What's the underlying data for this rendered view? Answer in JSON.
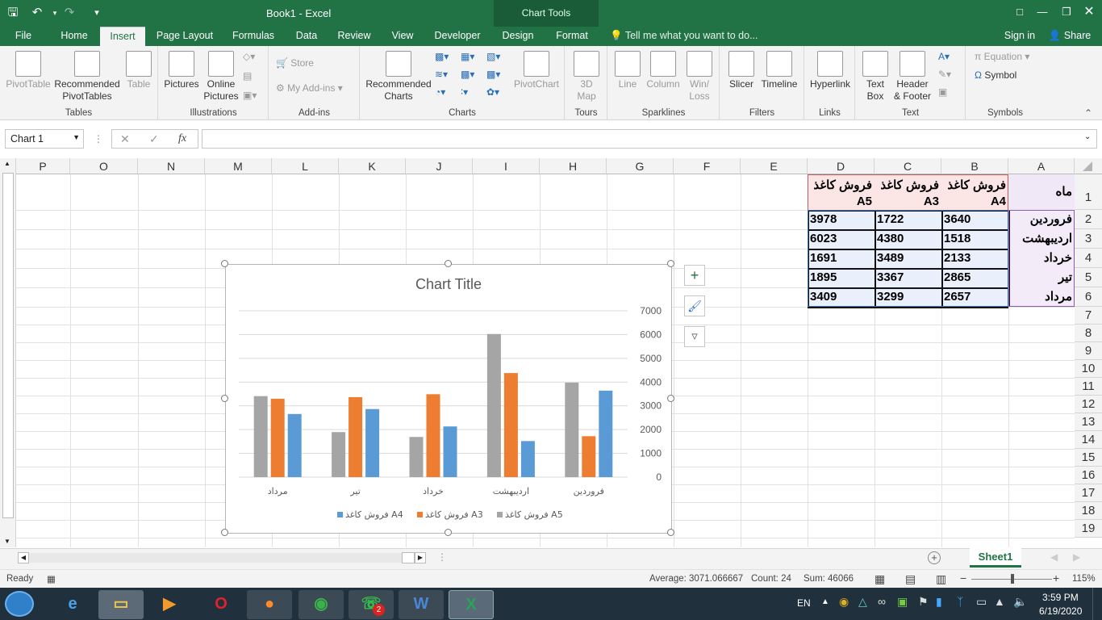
{
  "window": {
    "title": "Book1 - Excel",
    "chart_tools": "Chart Tools",
    "tell_me": "Tell me what you want to do...",
    "sign_in": "Sign in",
    "share": "Share"
  },
  "tabs": [
    "File",
    "Home",
    "Insert",
    "Page Layout",
    "Formulas",
    "Data",
    "Review",
    "View",
    "Developer",
    "Design",
    "Format"
  ],
  "active_tab": "Insert",
  "ribbon": {
    "tables": {
      "label": "Tables",
      "pivot": "PivotTable",
      "rec_pivot": "Recommended\nPivotTables",
      "table": "Table"
    },
    "illustrations": {
      "label": "Illustrations",
      "pictures": "Pictures",
      "online": "Online\nPictures"
    },
    "addins": {
      "label": "Add-ins",
      "store": "Store",
      "my_addins": "My Add-ins"
    },
    "charts": {
      "label": "Charts",
      "recommended": "Recommended\nCharts",
      "pivotchart": "PivotChart"
    },
    "tours": {
      "label": "Tours",
      "map": "3D\nMap"
    },
    "sparklines": {
      "label": "Sparklines",
      "line": "Line",
      "column": "Column",
      "winloss": "Win/\nLoss"
    },
    "filters": {
      "label": "Filters",
      "slicer": "Slicer",
      "timeline": "Timeline"
    },
    "links": {
      "label": "Links",
      "hyperlink": "Hyperlink"
    },
    "text": {
      "label": "Text",
      "textbox": "Text\nBox",
      "header": "Header\n& Footer"
    },
    "symbols": {
      "label": "Symbols",
      "equation": "Equation",
      "symbol": "Symbol"
    }
  },
  "formula_bar": {
    "name_box": "Chart 1",
    "fx": "fx",
    "value": ""
  },
  "columns": [
    "P",
    "O",
    "N",
    "M",
    "L",
    "K",
    "J",
    "I",
    "H",
    "G",
    "F",
    "E",
    "D",
    "C",
    "B",
    "A"
  ],
  "rows": [
    "1",
    "2",
    "3",
    "4",
    "5",
    "6",
    "7",
    "8",
    "9",
    "10",
    "11",
    "12",
    "13",
    "14",
    "15",
    "16",
    "17",
    "18",
    "19"
  ],
  "table": {
    "header": {
      "A": "ماه",
      "B": "فروش کاغذ A4",
      "C": "فروش کاغذ A3",
      "D": "فروش کاغذ A5"
    },
    "rows": [
      {
        "A": "فروردین",
        "B": "3640",
        "C": "1722",
        "D": "3978"
      },
      {
        "A": "اردیبهشت",
        "B": "1518",
        "C": "4380",
        "D": "6023"
      },
      {
        "A": "خرداد",
        "B": "2133",
        "C": "3489",
        "D": "1691"
      },
      {
        "A": "تیر",
        "B": "2865",
        "C": "3367",
        "D": "1895"
      },
      {
        "A": "مرداد",
        "B": "2657",
        "C": "3299",
        "D": "3409"
      }
    ]
  },
  "chart_data": {
    "type": "bar",
    "title": "Chart Title",
    "categories": [
      "فروردین",
      "اردیبهشت",
      "خرداد",
      "تیر",
      "مرداد"
    ],
    "x_reversed": true,
    "y_axis_side": "right",
    "ylim": [
      0,
      7000
    ],
    "yticks": [
      0,
      1000,
      2000,
      3000,
      4000,
      5000,
      6000,
      7000
    ],
    "series": [
      {
        "name": "فروش کاغذ A4",
        "color": "#5b9bd5",
        "values": [
          3640,
          1518,
          2133,
          2865,
          2657
        ]
      },
      {
        "name": "فروش کاغذ A3",
        "color": "#ed7d31",
        "values": [
          1722,
          4380,
          3489,
          3367,
          3299
        ]
      },
      {
        "name": "فروش کاغذ A5",
        "color": "#a5a5a5",
        "values": [
          3978,
          6023,
          1691,
          1895,
          3409
        ]
      }
    ],
    "legend_position": "bottom",
    "legend_order": [
      0,
      1,
      2
    ],
    "grid": true
  },
  "sheet": {
    "tab": "Sheet1"
  },
  "status": {
    "ready": "Ready",
    "average": "Average: 3071.066667",
    "count": "Count: 24",
    "sum": "Sum: 46066",
    "zoom": "115%"
  },
  "taskbar": {
    "lang": "EN",
    "time": "3:59 PM",
    "date": "6/19/2020",
    "whatsapp_badge": "2"
  }
}
